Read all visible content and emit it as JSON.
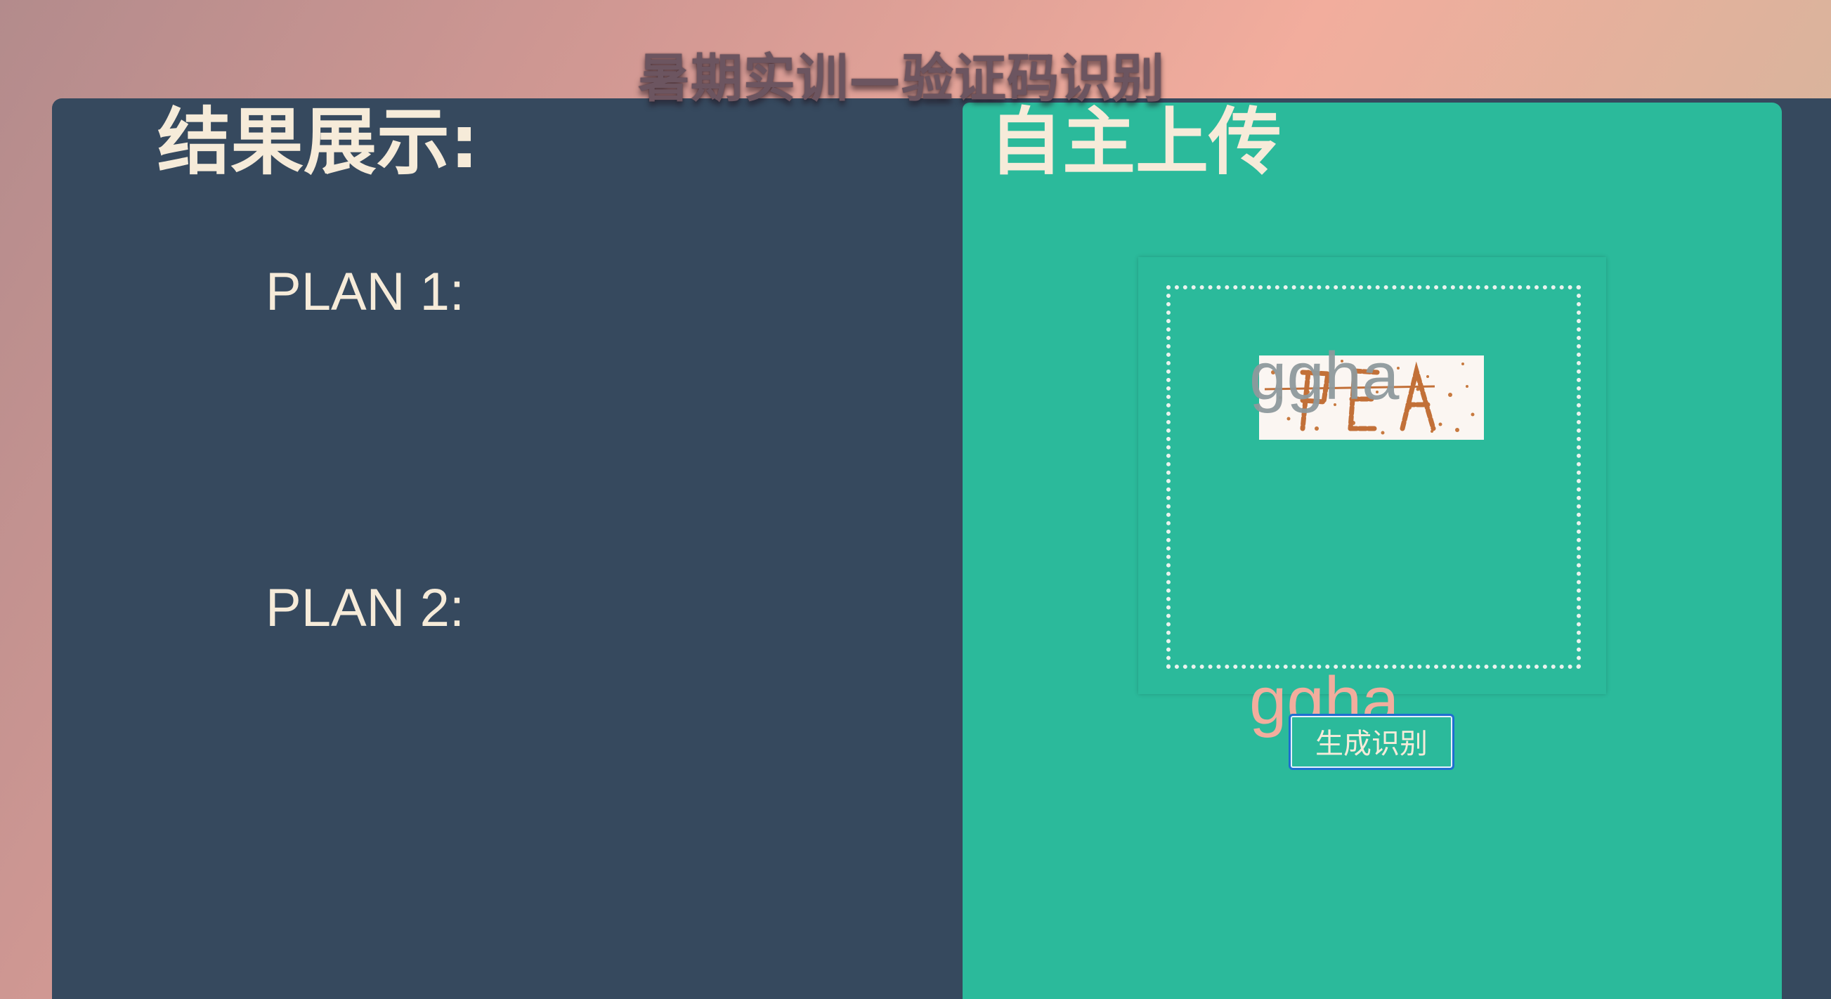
{
  "page": {
    "title": "暑期实训—验证码识别"
  },
  "results": {
    "heading": "结果展示:",
    "plan1_label": "PLAN 1:",
    "plan2_label": "PLAN 2:"
  },
  "upload": {
    "heading": "自主上传",
    "ocr_overlay": "ggha",
    "result_text": "ggha",
    "generate_button": "生成识别"
  },
  "colors": {
    "panel_bg": "#36495e",
    "upload_bg": "#2bba9b",
    "heading_text": "#f6ebd9",
    "result_text": "#f2ad9d",
    "button_border": "#1f6fd0"
  }
}
